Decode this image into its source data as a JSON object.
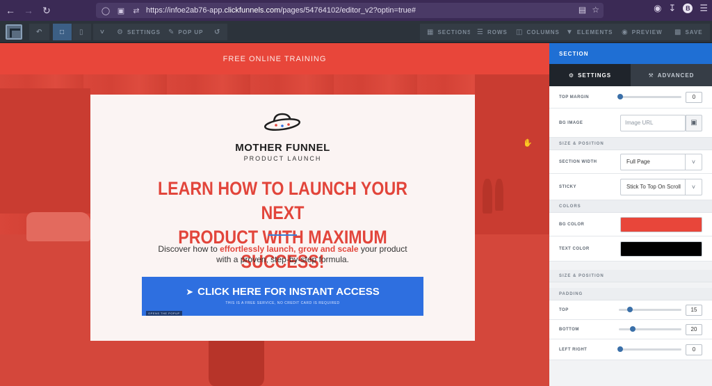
{
  "browser": {
    "url_prefix": "https://infoe2ab76-app.",
    "url_domain": "clickfunnels.com",
    "url_path": "/pages/54764102/editor_v2?optin=true#",
    "avatar_letter": "B"
  },
  "toolbar": {
    "settings": "SETTINGS",
    "popup": "POP UP",
    "sections": "SECTIONS",
    "rows": "ROWS",
    "columns": "COLUMNS",
    "elements": "ELEMENTS",
    "preview": "PREVIEW",
    "save": "SAVE"
  },
  "page": {
    "header_text": "FREE ONLINE TRAINING",
    "brand_name": "MOTHER FUNNEL",
    "brand_sub": "PRODUCT LAUNCH",
    "headline_line1": "LEARN HOW TO LAUNCH YOUR NEXT",
    "headline_line2": "PRODUCT WITH MAXIMUM SUCCESS!",
    "desc_pre": "Discover how to ",
    "desc_highlight": "effortlessly launch, grow and scale",
    "desc_mid": " your product",
    "desc_line2": "with a proven, step-by-step formula.",
    "cta_main": "CLICK HERE FOR INSTANT ACCESS",
    "cta_sub": "THIS IS A FREE SERVICE, NO CREDIT CARD IS REQUIRED",
    "cta_tag": "OPENS THE POPUP",
    "bg_color": "#e8463a"
  },
  "panel": {
    "title": "SECTION",
    "tab_settings": "SETTINGS",
    "tab_advanced": "ADVANCED",
    "top_margin_label": "TOP MARGIN",
    "top_margin_value": "0",
    "bg_image_label": "BG IMAGE",
    "bg_image_placeholder": "Image URL",
    "group_size_position": "SIZE & POSITION",
    "section_width_label": "SECTION WIDTH",
    "section_width_value": "Full Page",
    "sticky_label": "STICKY",
    "sticky_value": "Stick To Top On Scroll",
    "group_colors": "COLORS",
    "bg_color_label": "BG COLOR",
    "bg_color_value": "#e8463a",
    "text_color_label": "TEXT COLOR",
    "text_color_value": "#000000",
    "group_size_position_2": "SIZE & POSITION",
    "group_padding": "PADDING",
    "pad_top_label": "TOP",
    "pad_top_value": "15",
    "pad_bottom_label": "BOTTOM",
    "pad_bottom_value": "20",
    "pad_leftright_label": "LEFT RIGHT",
    "pad_leftright_value": "0"
  }
}
